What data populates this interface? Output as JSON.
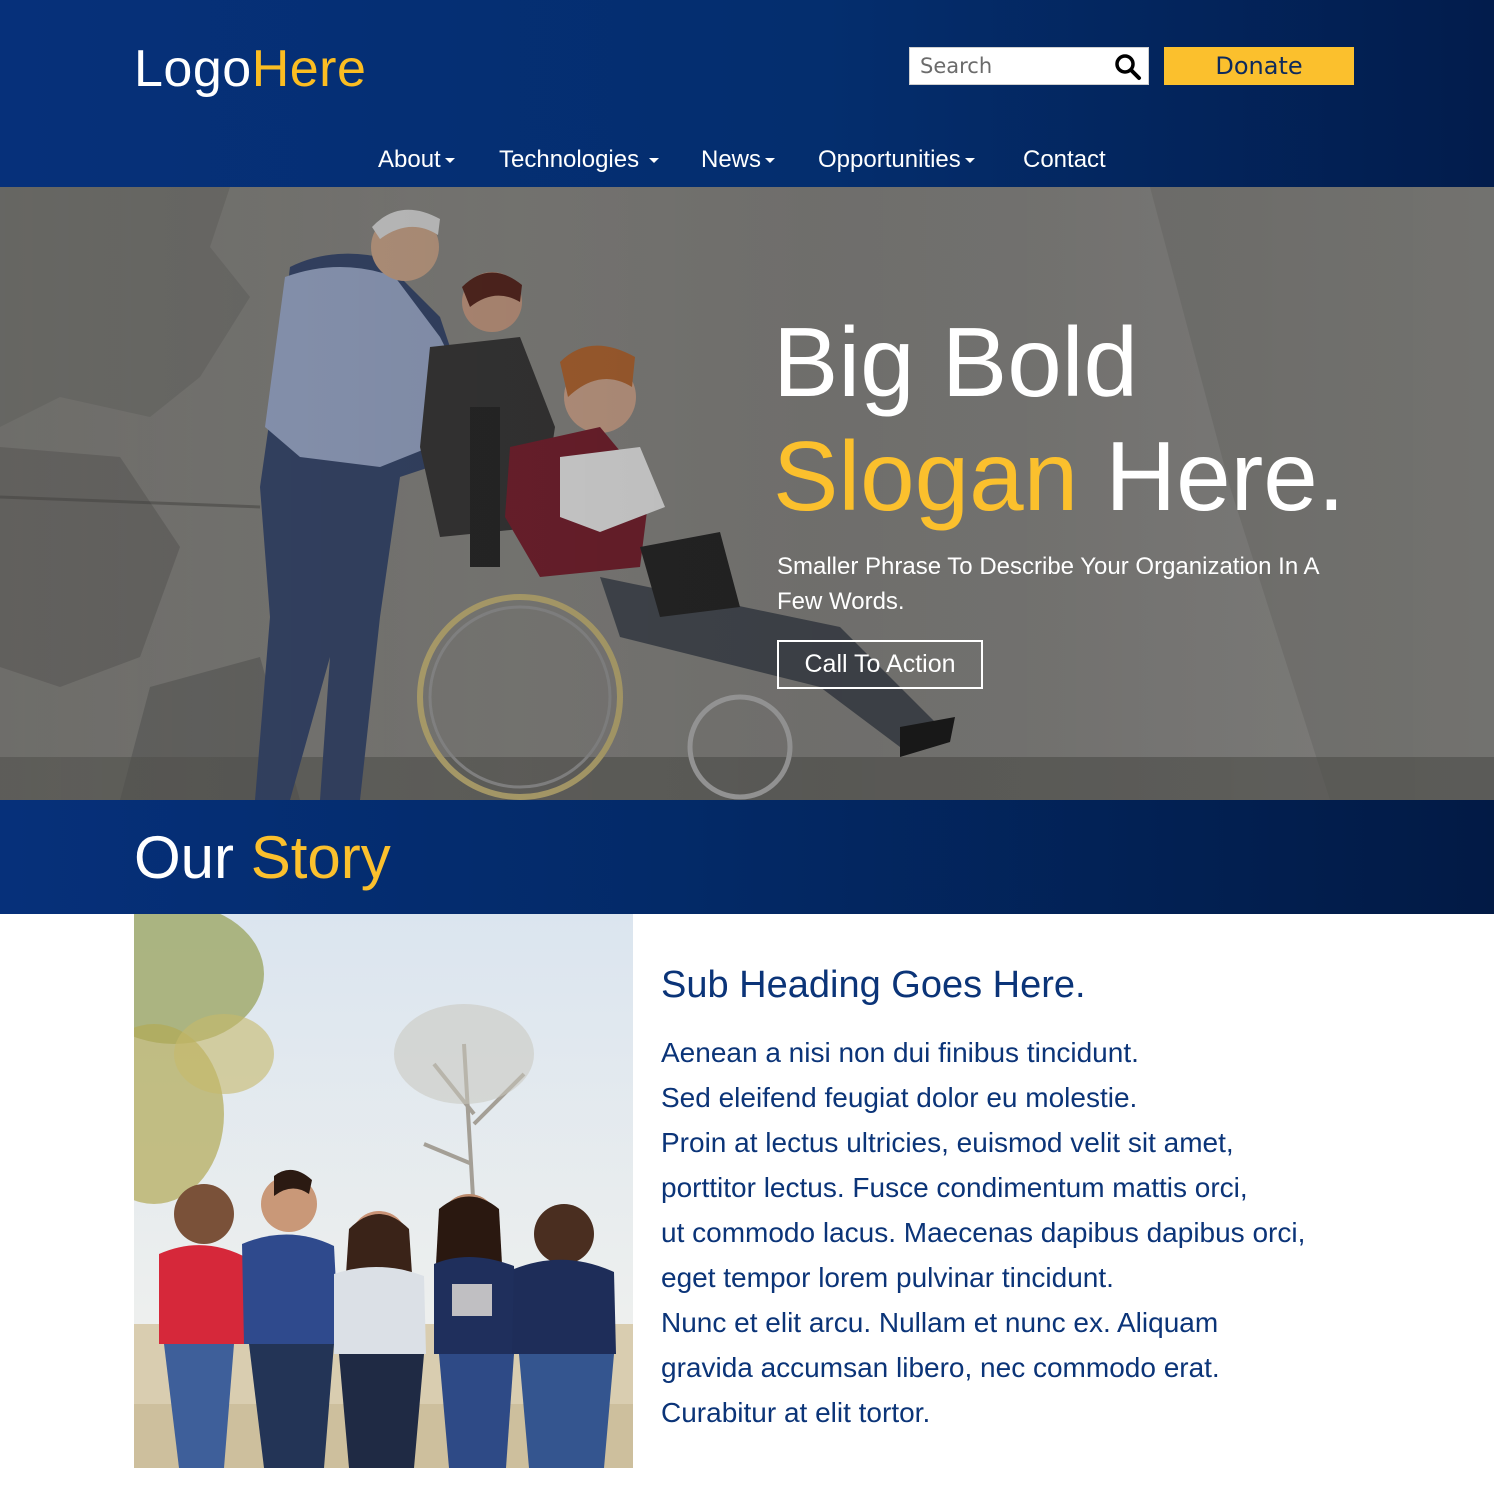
{
  "colors": {
    "brand_blue": "#06307a",
    "accent_yellow": "#fbc02d",
    "text_blue": "#0b3478"
  },
  "header": {
    "logo_main": "Logo",
    "logo_accent": "Here",
    "search_placeholder": "Search",
    "donate_label": "Donate",
    "nav": [
      {
        "label": "About",
        "has_dropdown": true
      },
      {
        "label": "Technologies",
        "has_dropdown": true
      },
      {
        "label": "News",
        "has_dropdown": true
      },
      {
        "label": "Opportunities",
        "has_dropdown": true
      },
      {
        "label": "Contact",
        "has_dropdown": false
      }
    ]
  },
  "hero": {
    "title_line1": "Big Bold",
    "title_accent": "Slogan",
    "title_rest": "Here.",
    "subtitle": "Smaller Phrase To Describe Your Organization In A Few Words.",
    "cta_label": "Call To Action"
  },
  "story": {
    "title_main": "Our",
    "title_accent": "Story",
    "sub_heading": "Sub Heading Goes Here.",
    "body_lines": [
      "Aenean a nisi non dui finibus tincidunt.",
      "Sed eleifend feugiat dolor eu molestie.",
      "Proin at lectus ultricies, euismod velit sit amet,",
      "porttitor lectus. Fusce condimentum mattis orci,",
      "ut commodo lacus. Maecenas dapibus dapibus orci,",
      "eget tempor lorem pulvinar tincidunt.",
      "Nunc et elit arcu. Nullam et nunc ex. Aliquam",
      "gravida accumsan libero, nec commodo erat.",
      "Curabitur at elit tortor."
    ]
  }
}
